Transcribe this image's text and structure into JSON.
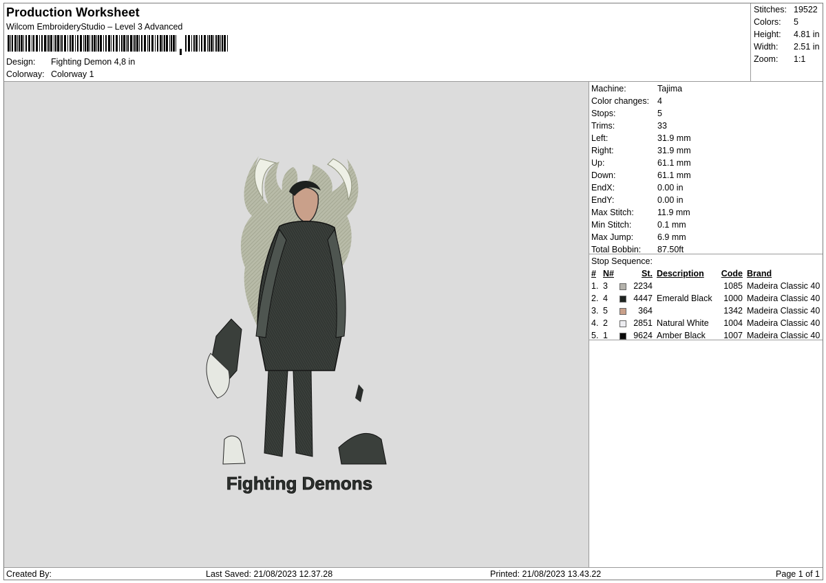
{
  "header": {
    "title": "Production Worksheet",
    "software": "Wilcom EmbroideryStudio – Level 3 Advanced",
    "design_label": "Design:",
    "design_value": "Fighting Demon 4,8 in",
    "colorway_label": "Colorway:",
    "colorway_value": "Colorway 1"
  },
  "summary": [
    {
      "label": "Stitches:",
      "value": "19522"
    },
    {
      "label": "Colors:",
      "value": "5"
    },
    {
      "label": "Height:",
      "value": "4.81 in"
    },
    {
      "label": "Width:",
      "value": "2.51 in"
    },
    {
      "label": "Zoom:",
      "value": "1:1"
    }
  ],
  "machine": [
    {
      "label": "Machine:",
      "value": "Tajima"
    },
    {
      "label": "Color changes:",
      "value": "4"
    },
    {
      "label": "Stops:",
      "value": "5"
    },
    {
      "label": "Trims:",
      "value": "33"
    },
    {
      "label": "Left:",
      "value": "31.9 mm"
    },
    {
      "label": "Right:",
      "value": "31.9 mm"
    },
    {
      "label": "Up:",
      "value": "61.1 mm"
    },
    {
      "label": "Down:",
      "value": "61.1 mm"
    },
    {
      "label": "EndX:",
      "value": "0.00 in"
    },
    {
      "label": "EndY:",
      "value": "0.00 in"
    },
    {
      "label": "Max Stitch:",
      "value": "11.9 mm"
    },
    {
      "label": "Min Stitch:",
      "value": "0.1 mm"
    },
    {
      "label": "Max Jump:",
      "value": "6.9 mm"
    },
    {
      "label": "Total Bobbin:",
      "value": "87.50ft"
    }
  ],
  "stop_sequence": {
    "title": "Stop Sequence:",
    "columns": {
      "num": "#",
      "n": "N#",
      "st": "St.",
      "description": "Description",
      "code": "Code",
      "brand": "Brand"
    },
    "rows": [
      {
        "num": "1.",
        "n": "3",
        "color": "#b4b2ab",
        "st": "2234",
        "description": "",
        "code": "1085",
        "brand": "Madeira Classic 40"
      },
      {
        "num": "2.",
        "n": "4",
        "color": "#1f2421",
        "st": "4447",
        "description": "Emerald Black",
        "code": "1000",
        "brand": "Madeira Classic 40"
      },
      {
        "num": "3.",
        "n": "5",
        "color": "#c9a08a",
        "st": "364",
        "description": "",
        "code": "1342",
        "brand": "Madeira Classic 40"
      },
      {
        "num": "4.",
        "n": "2",
        "color": "#ececf0",
        "st": "2851",
        "description": "Natural White",
        "code": "1004",
        "brand": "Madeira Classic 40"
      },
      {
        "num": "5.",
        "n": "1",
        "color": "#0a0a0a",
        "st": "9624",
        "description": "Amber Black",
        "code": "1007",
        "brand": "Madeira Classic 40"
      }
    ]
  },
  "preview": {
    "text": "Fighting  Demons"
  },
  "footer": {
    "created_by": "Created By:",
    "last_saved": "Last Saved: 21/08/2023 12.37.28",
    "printed": "Printed: 21/08/2023 13.43.22",
    "page": "Page 1 of 1"
  }
}
